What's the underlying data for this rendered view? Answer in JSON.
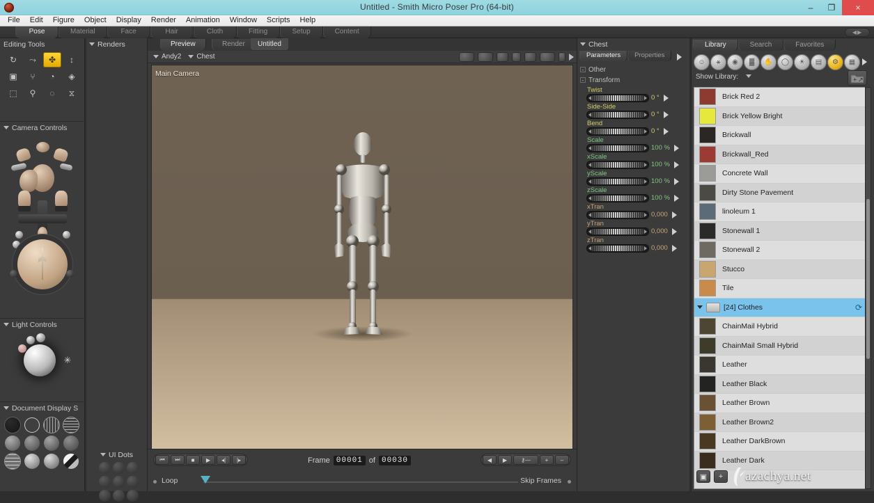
{
  "window": {
    "title": "Untitled - Smith Micro Poser Pro  (64-bit)",
    "app_icon": "poser-icon",
    "minimize": "–",
    "maximize": "❐",
    "close": "×"
  },
  "menubar": {
    "items": [
      "File",
      "Edit",
      "Figure",
      "Object",
      "Display",
      "Render",
      "Animation",
      "Window",
      "Scripts",
      "Help"
    ]
  },
  "room_tabs": {
    "items": [
      "Pose",
      "Material",
      "Face",
      "Hair",
      "Cloth",
      "Fitting",
      "Setup",
      "Content"
    ],
    "active": "Pose",
    "right_widget": "◀▶"
  },
  "left_panel": {
    "editing_tools": {
      "title": "Editing Tools",
      "tools": [
        {
          "name": "rotate-tool",
          "glyph": "↻",
          "active": false
        },
        {
          "name": "twist-tool",
          "glyph": "⤳",
          "active": false
        },
        {
          "name": "translate-pull-tool",
          "glyph": "✤",
          "active": true
        },
        {
          "name": "scale-tool",
          "glyph": "↕",
          "active": false
        },
        {
          "name": "taper-tool",
          "glyph": "▣",
          "active": false
        },
        {
          "name": "chain-break-tool",
          "glyph": "⑂",
          "active": false
        },
        {
          "name": "color-tool",
          "glyph": "◔",
          "active": false
        },
        {
          "name": "grouping-tool",
          "glyph": "◈",
          "active": false
        },
        {
          "name": "morph-tool",
          "glyph": "⬚",
          "active": false
        },
        {
          "name": "direct-manipulation-tool",
          "glyph": "⚲",
          "active": false
        },
        {
          "name": "view-magnifier-tool",
          "glyph": "◌",
          "active": false
        },
        {
          "name": "balance-tool",
          "glyph": "⧖",
          "active": false
        }
      ]
    },
    "camera_controls": {
      "title": "Camera Controls"
    },
    "light_controls": {
      "title": "Light Controls"
    },
    "document_display": {
      "title": "Document Display S",
      "styles": [
        "silhouette",
        "outline",
        "wireframe",
        "hidden-line",
        "lit-wireframe",
        "flat-shaded",
        "flat-lined",
        "smooth-shaded",
        "smooth-lined",
        "texture-shaded",
        "texture-lined",
        "cartoon"
      ]
    }
  },
  "renders_panel": {
    "title": "Renders"
  },
  "ui_dots": {
    "title": "UI Dots",
    "count": 9
  },
  "document": {
    "tabs": [
      "Preview",
      "Render"
    ],
    "active_tab": "Preview",
    "doc_name": "Untitled",
    "actor_selector": "Andy2",
    "part_selector": "Chest",
    "camera_label": "Main Camera",
    "view_icons": [
      "face-camera-icon",
      "head-camera-icon",
      "left-hand-camera-icon",
      "right-hand-camera-icon",
      "posing-camera-icon",
      "aux-camera-icon",
      "light-camera-icon",
      "next-camera-icon"
    ],
    "footer_swatches": [
      "#2e2e2e",
      "#b8a084",
      "#ab8d6a",
      "#d6c3a5"
    ]
  },
  "animation": {
    "transport": [
      {
        "name": "go-to-start-button",
        "glyph": "⏮"
      },
      {
        "name": "go-to-end-button",
        "glyph": "⏭"
      },
      {
        "name": "stop-button",
        "glyph": "■"
      },
      {
        "name": "play-button",
        "glyph": "▶"
      },
      {
        "name": "step-back-button",
        "glyph": "◂|"
      },
      {
        "name": "step-forward-button",
        "glyph": "|▸"
      }
    ],
    "frame_label": "Frame",
    "frame_current": "00001",
    "of_label": "of",
    "frame_total": "00030",
    "keyframe_tools": [
      {
        "name": "prev-keyframe-button",
        "glyph": "◀"
      },
      {
        "name": "next-keyframe-button",
        "glyph": "▶"
      },
      {
        "name": "edit-keyframes-button",
        "glyph": "⚷―"
      },
      {
        "name": "add-keyframe-button",
        "glyph": "+"
      },
      {
        "name": "delete-keyframe-button",
        "glyph": "–"
      }
    ],
    "loop_label": "Loop",
    "skip_frames_label": "Skip Frames"
  },
  "parameters": {
    "title": "Chest",
    "tabs": [
      "Parameters",
      "Properties"
    ],
    "active_tab": "Parameters",
    "groups": [
      {
        "name": "Other",
        "sign": "-"
      },
      {
        "name": "Transform",
        "sign": "-"
      }
    ],
    "dials": [
      {
        "label": "Twist",
        "value": "0 °",
        "color": "yellow",
        "fill": 50
      },
      {
        "label": "Side-Side",
        "value": "0 °",
        "color": "yellow",
        "fill": 50
      },
      {
        "label": "Bend",
        "value": "0 °",
        "color": "yellow",
        "fill": 50
      },
      {
        "label": "Scale",
        "value": "100 %",
        "color": "green",
        "fill": 50
      },
      {
        "label": "xScale",
        "value": "100 %",
        "color": "green",
        "fill": 50
      },
      {
        "label": "yScale",
        "value": "100 %",
        "color": "green",
        "fill": 50
      },
      {
        "label": "zScale",
        "value": "100 %",
        "color": "green",
        "fill": 50
      },
      {
        "label": "xTran",
        "value": "0,000",
        "color": "tan",
        "fill": 50
      },
      {
        "label": "yTran",
        "value": "0,000",
        "color": "tan",
        "fill": 50
      },
      {
        "label": "zTran",
        "value": "0,000",
        "color": "tan",
        "fill": 50
      }
    ]
  },
  "library": {
    "tabs": [
      "Library",
      "Search",
      "Favorites"
    ],
    "active_tab": "Library",
    "categories": [
      {
        "name": "figures-category",
        "glyph": "☺",
        "active": false
      },
      {
        "name": "poses-category",
        "glyph": "⚹",
        "active": false
      },
      {
        "name": "expressions-category",
        "glyph": "◉",
        "active": false
      },
      {
        "name": "hair-category",
        "glyph": "▓",
        "active": false
      },
      {
        "name": "hands-category",
        "glyph": "✋",
        "active": false
      },
      {
        "name": "props-category",
        "glyph": "◯",
        "active": false
      },
      {
        "name": "lights-category",
        "glyph": "☀",
        "active": false
      },
      {
        "name": "cameras-category",
        "glyph": "▤",
        "active": false
      },
      {
        "name": "materials-category",
        "glyph": "⚙",
        "active": true
      },
      {
        "name": "scenes-category",
        "glyph": "▦",
        "active": false
      }
    ],
    "show_library_label": "Show Library:",
    "add_folder_button": "add-library-folder",
    "items": [
      {
        "label": "Brick Red 2",
        "thumb": "#8d3a30",
        "type": "item"
      },
      {
        "label": "Brick Yellow Bright",
        "thumb": "#e7e83c",
        "type": "item"
      },
      {
        "label": "Brickwall",
        "thumb": "#2b2724",
        "type": "item"
      },
      {
        "label": "Brickwall_Red",
        "thumb": "#9c3b33",
        "type": "item"
      },
      {
        "label": "Concrete Wall",
        "thumb": "#9b9b97",
        "type": "item"
      },
      {
        "label": "Dirty Stone Pavement",
        "thumb": "#4b4a44",
        "type": "item"
      },
      {
        "label": "linoleum 1",
        "thumb": "#5d6a78",
        "type": "item"
      },
      {
        "label": "Stonewall 1",
        "thumb": "#2a2a28",
        "type": "item"
      },
      {
        "label": "Stonewall 2",
        "thumb": "#6e6a62",
        "type": "item"
      },
      {
        "label": "Stucco",
        "thumb": "#c9a56f",
        "type": "item"
      },
      {
        "label": "Tile",
        "thumb": "#c98a4a",
        "type": "item"
      },
      {
        "label": "[24]  Clothes",
        "thumb": "",
        "type": "folder",
        "selected": true,
        "refresh": "⟳"
      },
      {
        "label": "ChainMail Hybrid",
        "thumb": "#4c4632",
        "type": "item"
      },
      {
        "label": "ChainMail Small Hybrid",
        "thumb": "#3f3b2b",
        "type": "item"
      },
      {
        "label": "Leather",
        "thumb": "#3a3630",
        "type": "item"
      },
      {
        "label": "Leather Black",
        "thumb": "#232321",
        "type": "item"
      },
      {
        "label": "Leather Brown",
        "thumb": "#6b5134",
        "type": "item"
      },
      {
        "label": "Leather Brown2",
        "thumb": "#7d5f36",
        "type": "item"
      },
      {
        "label": "Leather DarkBrown",
        "thumb": "#4a3823",
        "type": "item"
      },
      {
        "label": "Leather Dark",
        "thumb": "#3b2d1d",
        "type": "item"
      }
    ]
  },
  "watermark": {
    "buttons": [
      {
        "name": "library-thumbnail-button",
        "glyph": "▣"
      },
      {
        "name": "library-add-button",
        "glyph": "+"
      }
    ],
    "text": "azachya.net",
    "logo": "k-logo"
  },
  "colors": {
    "accent_gold": "#e8b21c",
    "selection_blue": "#79c3ec",
    "titlebar": "#9fdbe3",
    "panel_bg": "#3b3b3b",
    "close_red": "#e04b4b"
  }
}
